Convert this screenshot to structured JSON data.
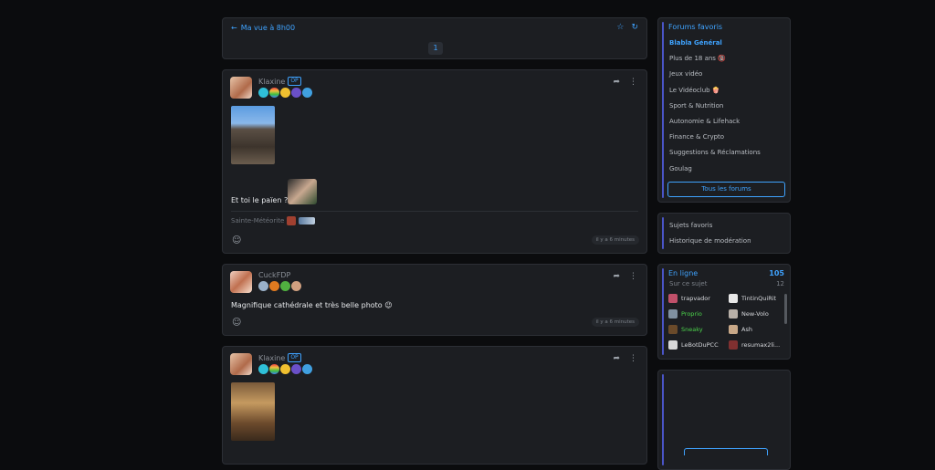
{
  "topbar": {
    "back_label": "Ma vue à 8h00",
    "page": "1"
  },
  "posts": [
    {
      "author": "Klaxine",
      "op": "OP",
      "text": "Et toi le païen ?",
      "signature": "Sainte-Météorite",
      "time": "il y a 6 minutes"
    },
    {
      "author": "CuckFDP",
      "text": "Magnifique cathédrale et très belle photo 😉",
      "time": "il y a 6 minutes"
    },
    {
      "author": "Klaxine",
      "op": "OP"
    }
  ],
  "sidebar": {
    "favorites_title": "Forums favoris",
    "forums": [
      "Blabla Général",
      "Plus de 18 ans 🔞",
      "Jeux vidéo",
      "Le Vidéoclub 🍿",
      "Sport & Nutrition",
      "Autonomie & Lifehack",
      "Finance & Crypto",
      "Suggestions & Réclamations",
      "Goulag"
    ],
    "all_forums_label": "Tous les forums",
    "links": [
      "Sujets favoris",
      "Historique de modération"
    ],
    "online": {
      "title": "En ligne",
      "count": "105",
      "subtitle": "Sur ce sujet",
      "subcount": "12",
      "users": [
        {
          "name": "trapvador",
          "color": "#d7d9dd",
          "avatar": "#c0506a"
        },
        {
          "name": "TintinQuiRit",
          "color": "#d7d9dd",
          "avatar": "#e8e8e8"
        },
        {
          "name": "Proprio",
          "color": "#4bd34b",
          "avatar": "#8090a0"
        },
        {
          "name": "New-Volo",
          "color": "#d7d9dd",
          "avatar": "#b8b0a8"
        },
        {
          "name": "Sneaky",
          "color": "#4bd34b",
          "avatar": "#6a4a2a"
        },
        {
          "name": "Ash",
          "color": "#d7d9dd",
          "avatar": "#c8a888"
        },
        {
          "name": "LeBotDuPCC",
          "color": "#d7d9dd",
          "avatar": "#d8d8d8"
        },
        {
          "name": "resumax2li...",
          "color": "#d7d9dd",
          "avatar": "#803030"
        }
      ]
    }
  }
}
